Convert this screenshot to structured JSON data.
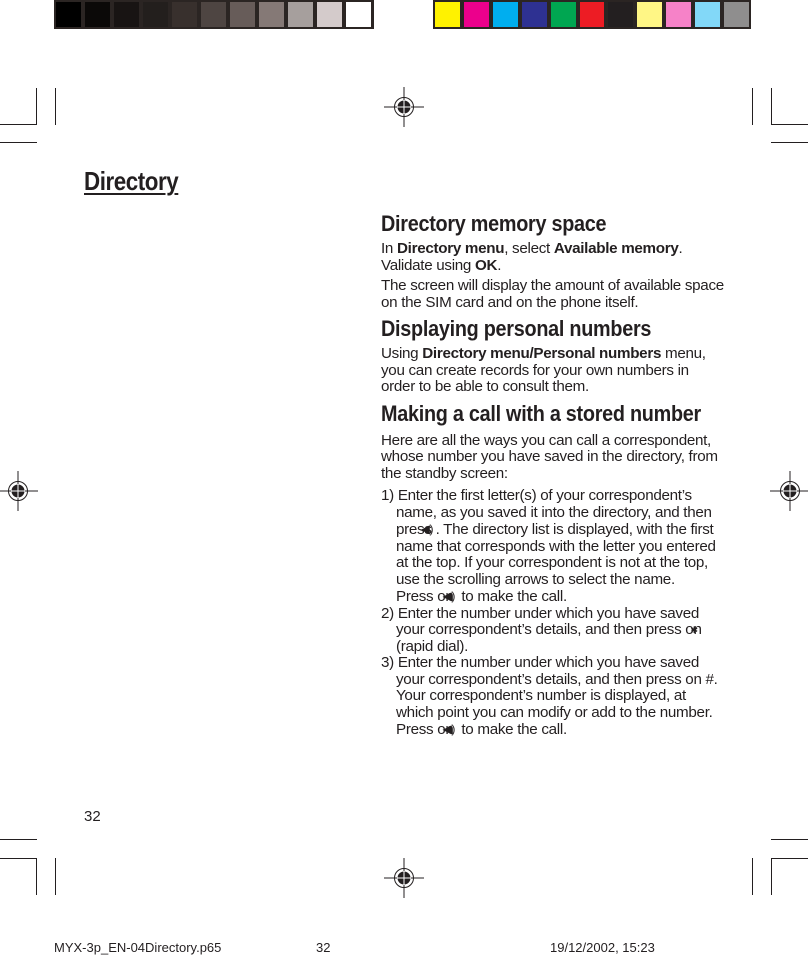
{
  "color_bars": {
    "grayscale": [
      "#000000",
      "#0b0908",
      "#181413",
      "#231f1d",
      "#38302d",
      "#4e4542",
      "#675c59",
      "#857976",
      "#a69f9d",
      "#d4cbcb",
      "#ffffff"
    ],
    "colors": [
      "#fff200",
      "#ec008c",
      "#00aeef",
      "#2e3192",
      "#00a651",
      "#ed1c24",
      "#231f20",
      "#fff685",
      "#f682c8",
      "#82d8f8",
      "#8f8e8e"
    ]
  },
  "page": {
    "chapter_title": "Directory",
    "page_number": "32"
  },
  "sections": [
    {
      "heading": "Directory memory space",
      "paragraphs": [
        {
          "parts": [
            {
              "t": "In ",
              "b": false
            },
            {
              "t": "Directory menu",
              "b": true
            },
            {
              "t": ", select ",
              "b": false
            },
            {
              "t": "Available memory",
              "b": true
            },
            {
              "t": ". Validate using ",
              "b": false
            },
            {
              "t": "OK",
              "b": true
            },
            {
              "t": ".",
              "b": false
            }
          ]
        },
        {
          "parts": [
            {
              "t": "The screen will display the amount of available space on the SIM card and on the phone itself.",
              "b": false
            }
          ]
        }
      ]
    },
    {
      "heading": "Displaying personal numbers",
      "paragraphs": [
        {
          "parts": [
            {
              "t": "Using ",
              "b": false
            },
            {
              "t": "Directory menu/Personal numbers",
              "b": true
            },
            {
              "t": " menu, you can create records for your own numbers in order to be able to consult them.",
              "b": false
            }
          ]
        }
      ]
    },
    {
      "heading": "Making a call with a stored number",
      "intro": "Here are all the ways you can call a correspondent, whose number you have saved in the directory, from the standby screen:",
      "steps": [
        {
          "number": "1)",
          "text_a": "Enter the first letter(s) of your correspondent’s name, as you saved it into the directory, and then press",
          "icon_a": "speaker-call-icon",
          "text_b": ". The directory list is displayed, with the first name that corresponds with the letter you entered at the top. If your correspondent is not at the top, use the scrolling arrows to select the name.",
          "text_c": "Press on",
          "icon_c": "speaker-call-icon",
          "text_d": "to make the call."
        },
        {
          "number": "2)",
          "text_a": "Enter the number under which you have saved your correspondent’s details, and then press on",
          "icon_a": "star-key-icon",
          "text_b": "(rapid dial)."
        },
        {
          "number": "3)",
          "text_a": "Enter the number under which you have saved your correspondent’s details, and then press on #.  Your correspondent’s number is displayed, at which point you can modify or add to the number. Press on",
          "icon_a": "speaker-call-icon",
          "text_b": "to make the call."
        }
      ]
    }
  ],
  "footer": {
    "filename": "MYX-3p_EN-04Directory.p65",
    "page": "32",
    "datetime": "19/12/2002, 15:23"
  },
  "glyphs": {
    "speaker": "◀)",
    "star": "✱"
  }
}
